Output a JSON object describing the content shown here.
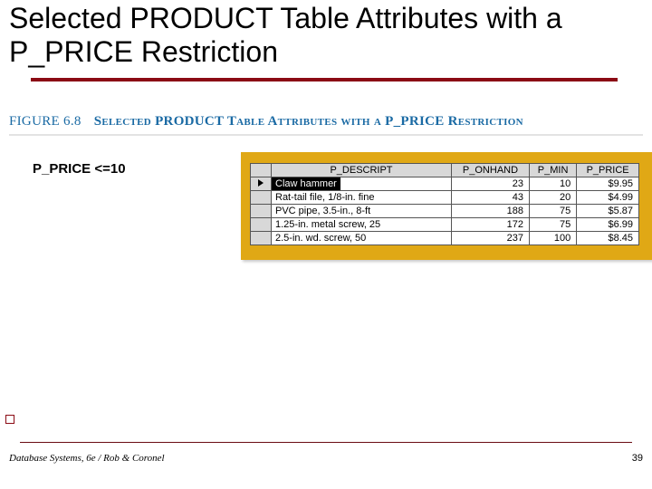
{
  "title": "Selected PRODUCT Table Attributes with a P_PRICE Restriction",
  "figure": {
    "number": "FIGURE 6.8",
    "caption": "Selected PRODUCT Table Attributes with a P_PRICE Restriction"
  },
  "restriction_label": "P_PRICE <=10",
  "table": {
    "headers": [
      "P_DESCRIPT",
      "P_ONHAND",
      "P_MIN",
      "P_PRICE"
    ],
    "rows": [
      {
        "selected": true,
        "p_descript": "Claw hammer",
        "p_onhand": 23,
        "p_min": 10,
        "p_price": "$9.95"
      },
      {
        "selected": false,
        "p_descript": "Rat-tail file, 1/8-in. fine",
        "p_onhand": 43,
        "p_min": 20,
        "p_price": "$4.99"
      },
      {
        "selected": false,
        "p_descript": "PVC pipe, 3.5-in., 8-ft",
        "p_onhand": 188,
        "p_min": 75,
        "p_price": "$5.87"
      },
      {
        "selected": false,
        "p_descript": "1.25-in. metal screw, 25",
        "p_onhand": 172,
        "p_min": 75,
        "p_price": "$6.99"
      },
      {
        "selected": false,
        "p_descript": "2.5-in. wd. screw, 50",
        "p_onhand": 237,
        "p_min": 100,
        "p_price": "$8.45"
      }
    ]
  },
  "footer": "Database Systems, 6e / Rob & Coronel",
  "page_number": "39"
}
